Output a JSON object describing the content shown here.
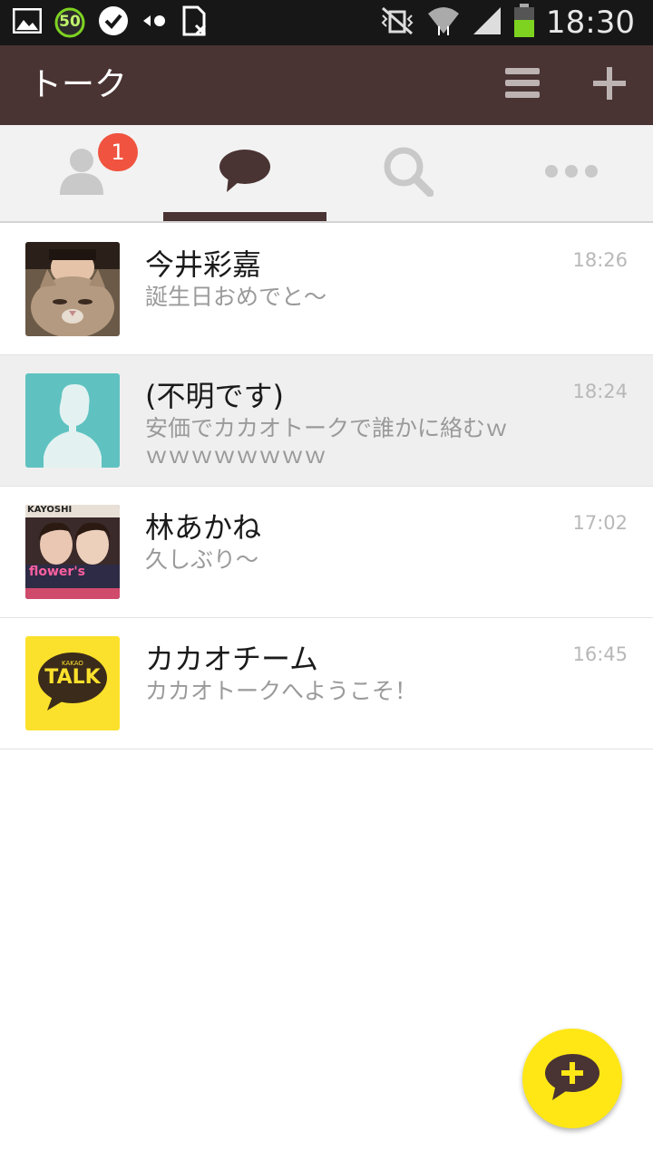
{
  "status_bar": {
    "time": "18:30",
    "left_icons": [
      "gallery-icon",
      "data-saver-icon",
      "check-icon",
      "nfc-icon",
      "no-sim-icon"
    ],
    "right_icons": [
      "mute-vibrate-icon",
      "wifi-icon",
      "signal-icon",
      "battery-icon"
    ],
    "data_saver_value": "50"
  },
  "header": {
    "title": "トーク",
    "menu_icon": "menu-icon",
    "add_icon": "plus-icon"
  },
  "tabs": [
    {
      "name": "friends",
      "icon": "person-icon",
      "badge": "1"
    },
    {
      "name": "chats",
      "icon": "chat-bubble-icon",
      "active": true
    },
    {
      "name": "search",
      "icon": "search-icon"
    },
    {
      "name": "more",
      "icon": "more-icon"
    }
  ],
  "chats": [
    {
      "name": "今井彩嘉",
      "message": "誕生日おめでと〜",
      "time": "18:26",
      "avatar": "photo-avatar"
    },
    {
      "name": "(不明です)",
      "message": "安価でカカオトークで誰かに絡むｗｗｗｗｗｗｗｗｗ",
      "time": "18:24",
      "avatar": "default-avatar"
    },
    {
      "name": "林あかね",
      "message": "久しぶり〜",
      "time": "17:02",
      "avatar": "photo-avatar"
    },
    {
      "name": "カカオチーム",
      "message": "カカオトークへようこそ！",
      "time": "16:45",
      "avatar": "kakao-talk-logo"
    }
  ],
  "avatar_text": {
    "kakao_small": "KAKAO",
    "kakao_big": "TALK",
    "photo_caption_1": "KAYOSHI",
    "photo_caption_2": "flower's"
  },
  "fab": {
    "icon": "new-chat-icon"
  },
  "colors": {
    "appbar": "#4a3333",
    "badge": "#f0533f",
    "fab": "#ffe716",
    "default_avatar_bg": "#5fc2c1"
  }
}
